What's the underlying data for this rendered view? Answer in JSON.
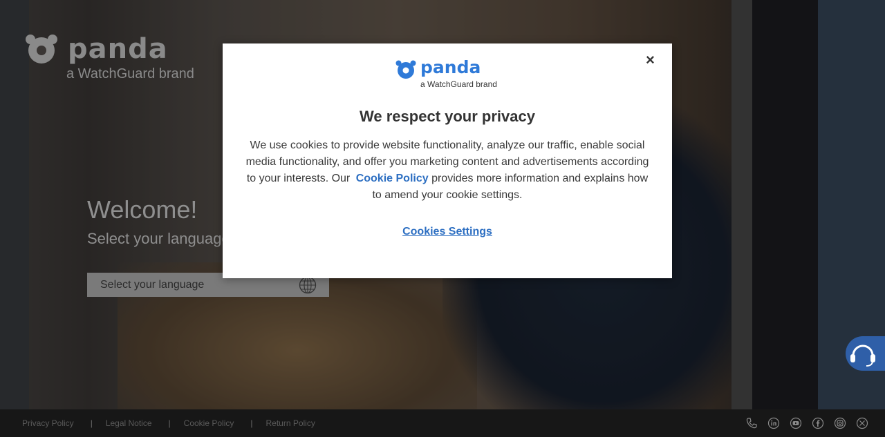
{
  "site": {
    "logo_word": "panda",
    "logo_brand": "a WatchGuard brand",
    "welcome_title": "Welcome!",
    "welcome_subtitle": "Select your language",
    "language_select_placeholder": "Select your language"
  },
  "footer": {
    "links": [
      "Privacy Policy",
      "Legal Notice",
      "Cookie Policy",
      "Return Policy"
    ],
    "separator": "|",
    "socials": [
      "phone-icon",
      "linkedin-icon",
      "youtube-icon",
      "facebook-icon",
      "instagram-icon",
      "x-twitter-icon"
    ]
  },
  "modal": {
    "logo_word": "panda",
    "logo_brand": "a WatchGuard brand",
    "close_label": "×",
    "title": "We respect your privacy",
    "body_before": "We use cookies to provide website functionality, analyze our traffic, enable social media functionality, and offer you marketing content and advertisements according to your interests. Our",
    "body_link": "Cookie Policy",
    "body_after": " provides more information and explains how to amend your cookie settings.",
    "settings_button": "Cookies Settings"
  },
  "colors": {
    "accent": "#2d6fc2",
    "modal_logo": "#2f7ad8",
    "footer_bg": "#171717",
    "help_bubble": "#2f5fa8"
  }
}
